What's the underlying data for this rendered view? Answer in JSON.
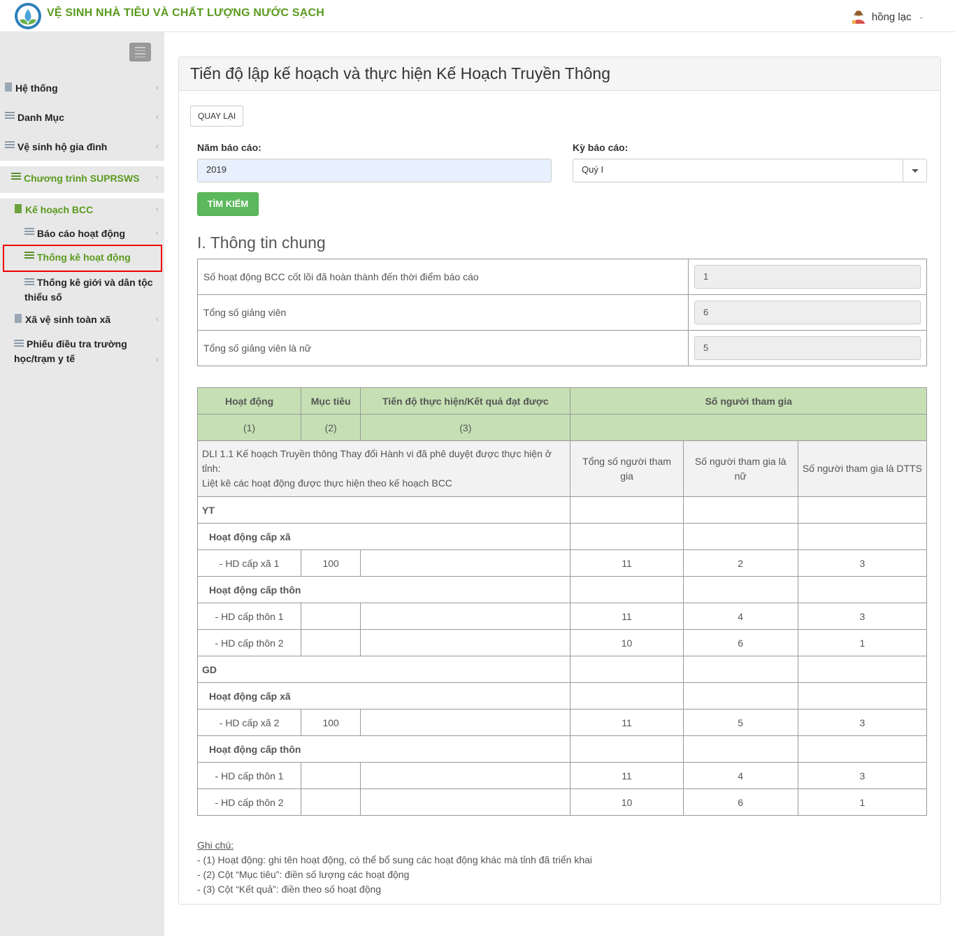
{
  "header": {
    "title": "VỆ SINH NHÀ TIÊU VÀ CHẤT LƯỢNG NƯỚC SẠCH",
    "user_name": "hồng lạc",
    "user_icon": "user-avatar-icon"
  },
  "sidebar": {
    "items": [
      {
        "label": "Hệ thống"
      },
      {
        "label": "Danh Mục"
      },
      {
        "label": "Vệ sinh hộ gia đình"
      },
      {
        "label": "Chương trình SUPRSWS"
      },
      {
        "label": "Kế hoạch BCC"
      },
      {
        "label": "Báo cáo hoạt động"
      },
      {
        "label": "Thống kê hoạt động"
      },
      {
        "label": "Thống kê giới và dân tộc thiểu số"
      },
      {
        "label": "Xã vệ sinh toàn xã"
      },
      {
        "label": "Phiếu điều tra trường học/trạm y tế"
      }
    ],
    "active": "Thống kê hoạt động"
  },
  "panel": {
    "title": "Tiến độ lập kế hoạch và thực hiện Kế Hoạch Truyền Thông",
    "back_label": "QUAY LẠI",
    "year_label": "Năm báo cáo:",
    "year_value": "2019",
    "period_label": "Kỳ báo cáo:",
    "period_value": "Quý I",
    "search_label": "TÌM KIẾM",
    "section_title": "I. Thông tin chung"
  },
  "info": [
    {
      "label": "Số hoạt động BCC cốt lõi đã hoàn thành đến thời điểm báo cáo",
      "value": "1"
    },
    {
      "label": "Tổng số giảng viên",
      "value": "6"
    },
    {
      "label": "Tổng số giảng viên là nữ",
      "value": "5"
    }
  ],
  "table": {
    "headers": {
      "activity": "Hoạt động",
      "target": "Mục tiêu",
      "progress": "Tiến độ thực hiện/Kết quả đạt được",
      "participants": "Số người tham gia",
      "n1": "(1)",
      "n2": "(2)",
      "n3": "(3)"
    },
    "desc_lines": [
      "DLI 1.1 Kế hoạch Truyền thông Thay đổi Hành vi đã phê duyệt được thực hiện ở tỉnh:",
      "Liệt kê các hoạt động được thực hiện theo kế hoạch BCC"
    ],
    "sub_headers": {
      "total": "Tổng số người tham gia",
      "female": "Số người tham gia là nữ",
      "ethnic": "Số người tham gia là DTTS"
    },
    "groups": [
      {
        "name": "YT",
        "sections": [
          {
            "name": "Hoạt động cấp xã",
            "rows": [
              {
                "activity": "- HD cấp xã 1",
                "target": "100",
                "progress": "",
                "total": "11",
                "female": "2",
                "ethnic": "3"
              }
            ]
          },
          {
            "name": "Hoạt động cấp thôn",
            "rows": [
              {
                "activity": "- HD cấp thôn 1",
                "target": "",
                "progress": "",
                "total": "11",
                "female": "4",
                "ethnic": "3"
              },
              {
                "activity": "- HD cấp thôn 2",
                "target": "",
                "progress": "",
                "total": "10",
                "female": "6",
                "ethnic": "1"
              }
            ]
          }
        ]
      },
      {
        "name": "GD",
        "sections": [
          {
            "name": "Hoạt động cấp xã",
            "rows": [
              {
                "activity": "- HD cấp xã 2",
                "target": "100",
                "progress": "",
                "total": "11",
                "female": "5",
                "ethnic": "3"
              }
            ]
          },
          {
            "name": "Hoạt động cấp thôn",
            "rows": [
              {
                "activity": "- HD cấp thôn 1",
                "target": "",
                "progress": "",
                "total": "11",
                "female": "4",
                "ethnic": "3"
              },
              {
                "activity": "- HD cấp thôn 2",
                "target": "",
                "progress": "",
                "total": "10",
                "female": "6",
                "ethnic": "1"
              }
            ]
          }
        ]
      }
    ]
  },
  "notes": {
    "heading": "Ghi chú:",
    "lines": [
      "- (1) Hoạt động: ghi tên hoạt động, có thể bổ sung các hoạt động khác mà tỉnh đã triển khai",
      "- (2) Cột “Mục tiêu”: điền số lượng các hoạt động",
      "- (3) Cột “Kết quả”: điền theo số hoạt động"
    ]
  }
}
